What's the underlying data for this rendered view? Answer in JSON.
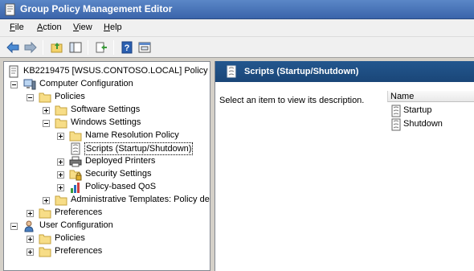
{
  "window": {
    "title": "Group Policy Management Editor"
  },
  "menu": [
    {
      "accel": "F",
      "rest": "ile"
    },
    {
      "accel": "A",
      "rest": "ction"
    },
    {
      "accel": "V",
      "rest": "iew"
    },
    {
      "accel": "H",
      "rest": "elp"
    }
  ],
  "toolbar": {
    "icons": [
      "back-arrow-icon",
      "forward-arrow-icon",
      "up-folder-icon",
      "show-hide-tree-icon",
      "export-list-icon",
      "help-icon",
      "properties-icon"
    ]
  },
  "tree": {
    "root": "KB2219475 [WSUS.CONTOSO.LOCAL] Policy",
    "computer_configuration": "Computer Configuration",
    "policies": "Policies",
    "software_settings": "Software Settings",
    "windows_settings": "Windows Settings",
    "name_resolution_policy": "Name Resolution Policy",
    "scripts": "Scripts (Startup/Shutdown)",
    "deployed_printers": "Deployed Printers",
    "security_settings": "Security Settings",
    "policy_qos": "Policy-based QoS",
    "admin_templates": "Administrative Templates: Policy defi",
    "preferences": "Preferences",
    "user_configuration": "User Configuration",
    "user_policies": "Policies",
    "user_preferences": "Preferences"
  },
  "details": {
    "title": "Scripts (Startup/Shutdown)",
    "description": "Select an item to view its description.",
    "column_name": "Name",
    "items": [
      "Startup",
      "Shutdown"
    ]
  }
}
